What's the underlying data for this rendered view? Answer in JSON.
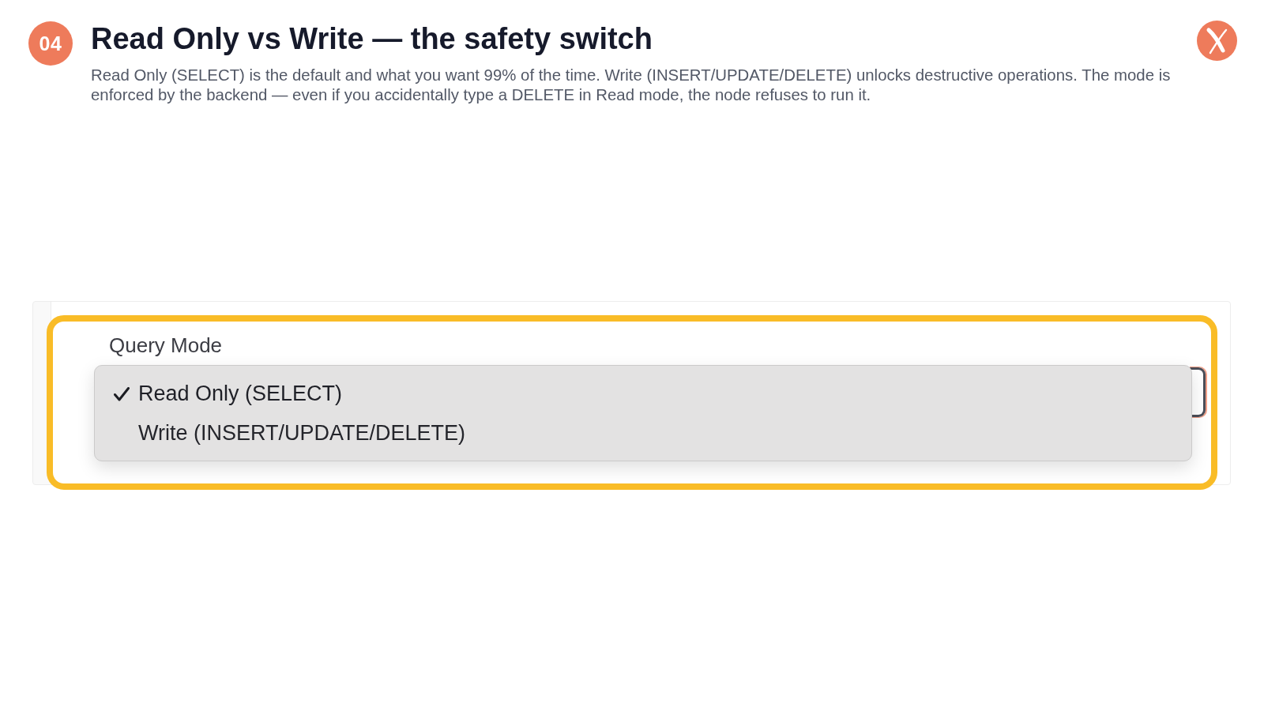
{
  "slide": {
    "number": "04",
    "title": "Read Only vs Write — the safety switch",
    "description": "Read Only (SELECT) is the default and what you want 99% of the time. Write (INSERT/UPDATE/DELETE) unlocks destructive operations. The mode is enforced by the backend — even if you accidentally type a DELETE in Read mode, the node refuses to run it."
  },
  "screenshot": {
    "field_label": "Query Mode",
    "menu": {
      "options": [
        {
          "label": "Read Only (SELECT)",
          "selected": true
        },
        {
          "label": "Write (INSERT/UPDATE/DELETE)",
          "selected": false
        }
      ]
    }
  }
}
